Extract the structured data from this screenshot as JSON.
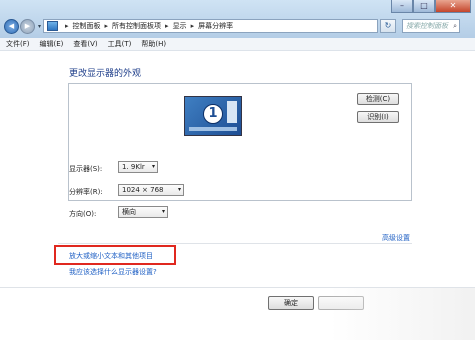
{
  "window": {
    "controls": {
      "minimize": "–",
      "maximize": "□",
      "close": "✕"
    }
  },
  "nav": {
    "back_icon": "◀",
    "forward_icon": "▶",
    "dropdown_icon": "▾",
    "refresh_icon": "↻",
    "breadcrumb": [
      "控制面板",
      "所有控制面板项",
      "显示",
      "屏幕分辨率"
    ],
    "search_placeholder": "搜索控制面板",
    "search_icon": "⌕"
  },
  "menu": [
    "文件(F)",
    "编辑(E)",
    "查看(V)",
    "工具(T)",
    "帮助(H)"
  ],
  "main": {
    "title": "更改显示器的外观",
    "monitor_number": "1",
    "detect_label": "检测(C)",
    "identify_label": "识别(I)",
    "display_label": "显示器(S):",
    "display_value": "1. 9Klr",
    "resolution_label": "分辨率(R):",
    "resolution_value": "1024 × 768",
    "orientation_label": "方向(O):",
    "orientation_value": "横向",
    "advanced_link": "高级设置",
    "magnify_link": "放大或缩小文本和其他项目",
    "help_link": "我应该选择什么显示器设置?",
    "ok_label": "确定",
    "select_arrow": "▾"
  },
  "colors": {
    "accent": "#1e5fc4",
    "highlight": "#e0281f"
  }
}
